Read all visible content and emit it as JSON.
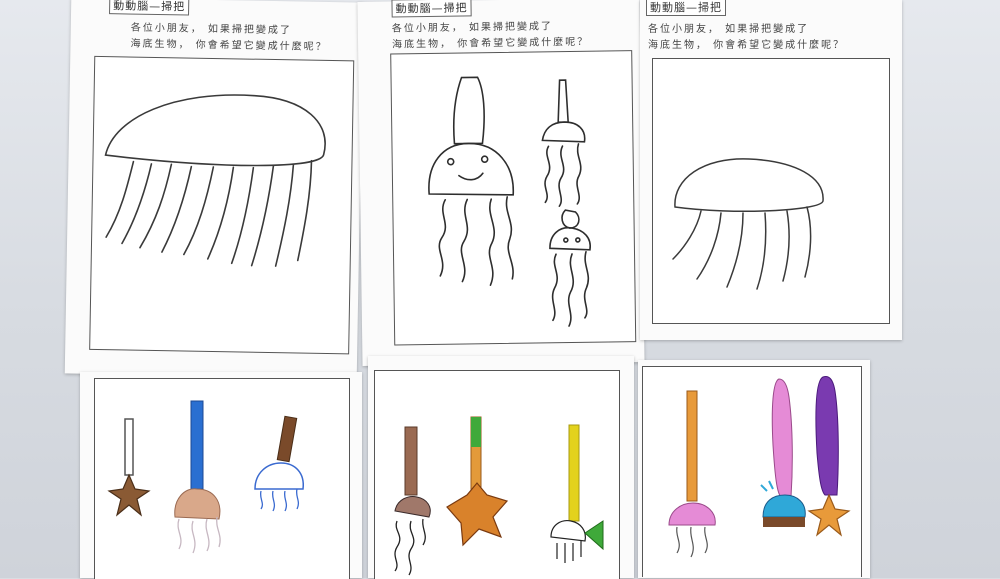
{
  "worksheets": [
    {
      "title": "動動腦—掃把",
      "line1": "各位小朋友， 如果掃把變成了",
      "line2": "海底生物， 你會希望它變成什麼呢？"
    },
    {
      "title": "動動腦—掃把",
      "line1": "各位小朋友， 如果掃把變成了",
      "line2": "海底生物， 你會希望它變成什麼呢？"
    },
    {
      "title": "動動腦—掃把",
      "line1": "各位小朋友， 如果掃把變成了",
      "line2": "海底生物， 你會希望它變成什麼呢？"
    }
  ],
  "drawings": {
    "top": [
      "jellyfish-pencil-sketch",
      "squid-and-jellyfish-sketch",
      "small-jellyfish-sketch"
    ],
    "bottom": [
      "three-broom-creatures-brown-blue",
      "three-broom-creatures-orange-green-yellow",
      "three-broom-creatures-pink-purple"
    ]
  },
  "colors": {
    "wall": "#d9dde2",
    "paper": "#fbfbfb",
    "pencil": "#3a3a3a",
    "brown": "#7a4a2a",
    "blue": "#2a6fd1",
    "orange": "#d9822b",
    "green": "#3fa93a",
    "yellow": "#e3d21c",
    "pink": "#e58bd6",
    "purple": "#7a3ab0"
  }
}
